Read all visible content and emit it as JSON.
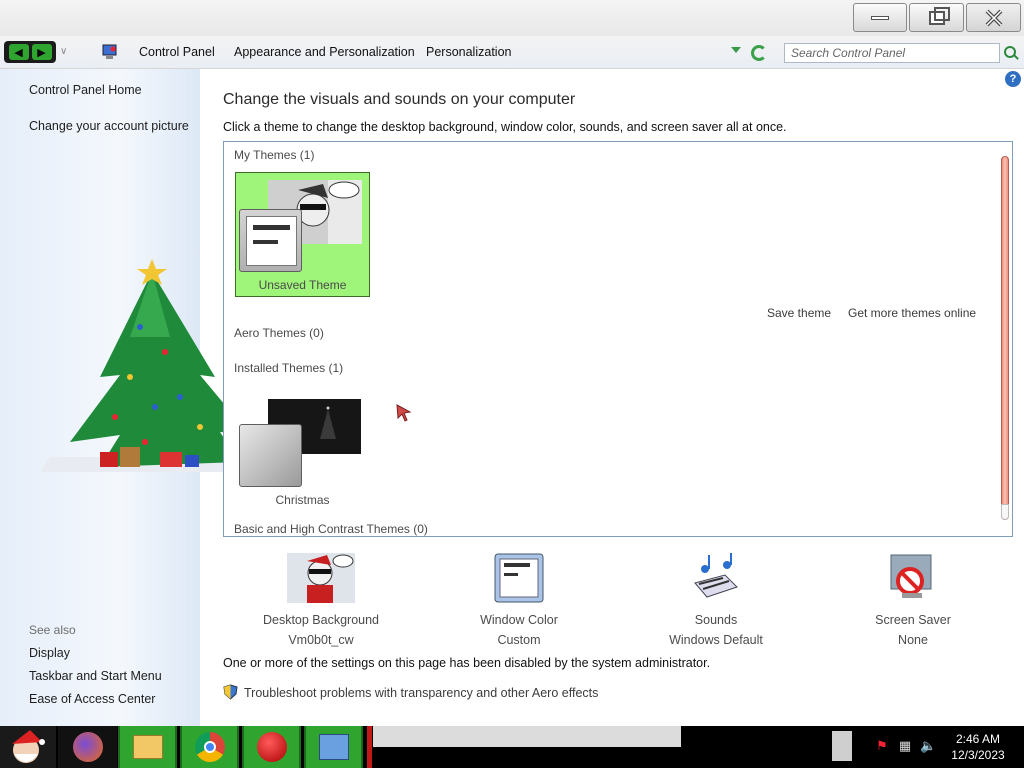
{
  "breadcrumb": [
    "Control Panel",
    "Appearance and Personalization",
    "Personalization"
  ],
  "search": {
    "placeholder": "Search Control Panel"
  },
  "sidebar": {
    "links": [
      "Control Panel Home",
      "Change your account picture"
    ],
    "see_also_label": "See also",
    "see_also": [
      "Display",
      "Taskbar and Start Menu",
      "Ease of Access Center"
    ]
  },
  "main": {
    "title": "Change the visuals and sounds on your computer",
    "subtitle": "Click a theme to change the desktop background, window color, sounds, and screen saver all at once.",
    "groups": {
      "my_themes": "My Themes (1)",
      "aero_themes": "Aero Themes (0)",
      "installed_themes": "Installed Themes (1)",
      "basic_themes": "Basic and High Contrast Themes (0)"
    },
    "themes": {
      "unsaved": "Unsaved Theme",
      "christmas": "Christmas"
    },
    "actions": {
      "save_theme": "Save theme",
      "get_more": "Get more themes online"
    },
    "settings": [
      {
        "name": "Desktop Background",
        "value": "Vm0b0t_cw"
      },
      {
        "name": "Window Color",
        "value": "Custom"
      },
      {
        "name": "Sounds",
        "value": "Windows Default"
      },
      {
        "name": "Screen Saver",
        "value": "None"
      }
    ],
    "admin_note": "One or more of the settings on this page has been disabled by the system administrator.",
    "troubleshoot": "Troubleshoot problems with transparency and other Aero effects"
  },
  "taskbar": {
    "time": "2:46 AM",
    "date": "12/3/2023",
    "apps": [
      "santa-start-icon",
      "firefox-icon",
      "file-explorer-icon",
      "chrome-icon",
      "red-ball-icon",
      "control-panel-icon"
    ]
  },
  "colors": {
    "theme_selected": "#9ff47a",
    "taskbar_active": "#2fa52f",
    "scrollbar": "#f08e7e"
  }
}
